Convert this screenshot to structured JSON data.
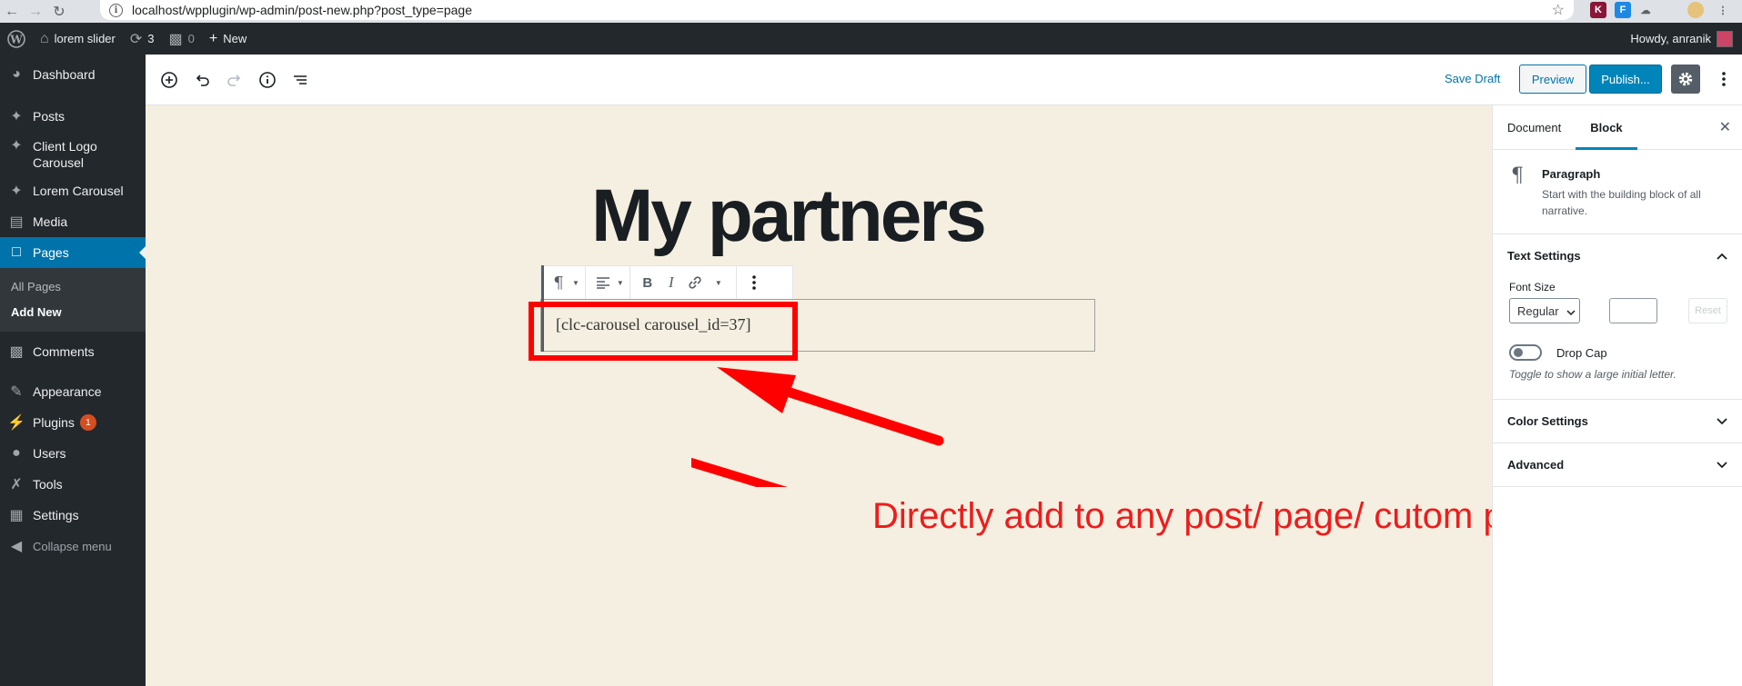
{
  "browser": {
    "url": "localhost/wpplugin/wp-admin/post-new.php?post_type=page"
  },
  "adminbar": {
    "site_name": "lorem slider",
    "updates_count": "3",
    "comments_count": "0",
    "new_label": "New",
    "howdy": "Howdy, anranik"
  },
  "sidebar": {
    "items": [
      {
        "label": "Dashboard"
      },
      {
        "label": "Posts"
      },
      {
        "label": "Client Logo Carousel"
      },
      {
        "label": "Lorem Carousel"
      },
      {
        "label": "Media"
      },
      {
        "label": "Pages"
      },
      {
        "label": "Comments"
      },
      {
        "label": "Appearance"
      },
      {
        "label": "Plugins",
        "badge": "1"
      },
      {
        "label": "Users"
      },
      {
        "label": "Tools"
      },
      {
        "label": "Settings"
      }
    ],
    "submenu": [
      "All Pages",
      "Add New"
    ],
    "collapse": "Collapse menu"
  },
  "header": {
    "save_draft": "Save Draft",
    "preview": "Preview",
    "publish": "Publish..."
  },
  "editor": {
    "title": "My partners",
    "paragraph": "[clc-carousel carousel_id=37]",
    "annotation": "Directly add to any post/ page/ cutom post"
  },
  "settings": {
    "tabs": [
      "Document",
      "Block"
    ],
    "block_name": "Paragraph",
    "block_desc": "Start with the building block of all narrative.",
    "text_settings": "Text Settings",
    "font_size_label": "Font Size",
    "font_size_value": "Regular",
    "reset": "Reset",
    "drop_cap": "Drop Cap",
    "drop_cap_help": "Toggle to show a large initial letter.",
    "color_settings": "Color Settings",
    "advanced": "Advanced"
  },
  "colors": {
    "wp_blue": "#0073aa",
    "canvas_bg": "#f4efe0",
    "annotation_red": "#ee1c1c"
  }
}
